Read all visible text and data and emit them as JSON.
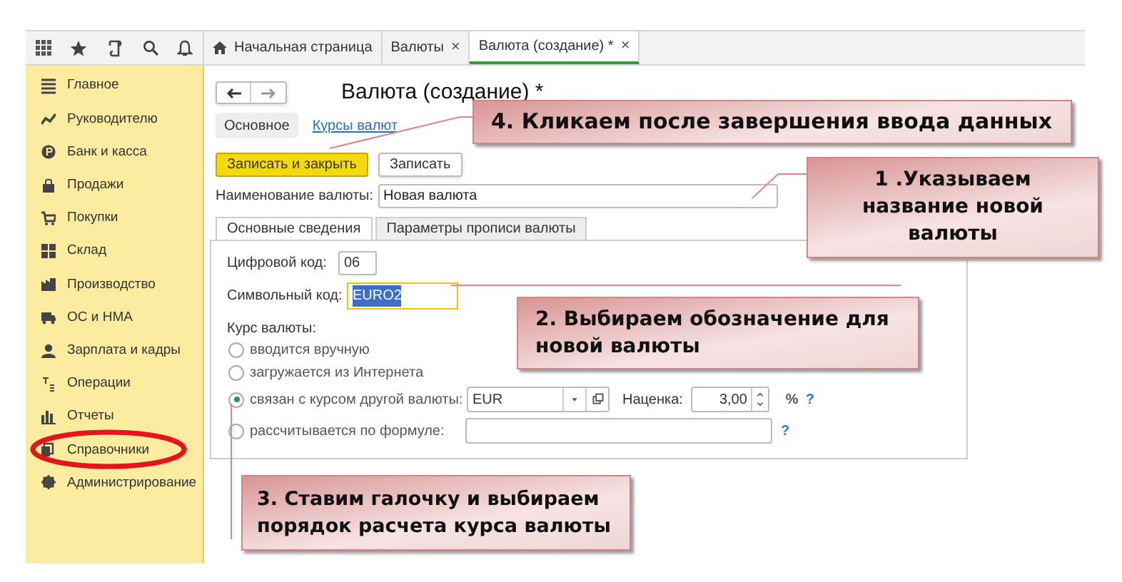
{
  "tabs": [
    {
      "label": "Начальная страница",
      "home": true,
      "closable": false,
      "selected": false
    },
    {
      "label": "Валюты",
      "home": false,
      "closable": true,
      "selected": false
    },
    {
      "label": "Валюта (создание) *",
      "home": false,
      "closable": true,
      "selected": true
    }
  ],
  "close_glyph": "×",
  "sidebar": {
    "items": [
      {
        "label": "Главное",
        "circled": false
      },
      {
        "label": "Руководителю",
        "circled": false
      },
      {
        "label": "Банк и касса",
        "circled": false
      },
      {
        "label": "Продажи",
        "circled": false
      },
      {
        "label": "Покупки",
        "circled": false
      },
      {
        "label": "Склад",
        "circled": false
      },
      {
        "label": "Производство",
        "circled": false
      },
      {
        "label": "ОС и НМА",
        "circled": false
      },
      {
        "label": "Зарплата и кадры",
        "circled": false
      },
      {
        "label": "Операции",
        "circled": false
      },
      {
        "label": "Отчеты",
        "circled": false
      },
      {
        "label": "Справочники",
        "circled": true
      },
      {
        "label": "Администрирование",
        "circled": false
      }
    ]
  },
  "form": {
    "title": "Валюта (создание) *",
    "sections": [
      {
        "label": "Основное",
        "kind": "button"
      },
      {
        "label": "Курсы валют",
        "kind": "link"
      }
    ],
    "actions": [
      {
        "label": "Записать и закрыть",
        "primary": true
      },
      {
        "label": "Записать",
        "primary": false
      }
    ],
    "name_field": {
      "label": "Наименование валюты:",
      "value": "Новая валюта"
    },
    "tabs": [
      {
        "label": "Основные сведения",
        "selected": true
      },
      {
        "label": "Параметры прописи валюты",
        "selected": false
      }
    ],
    "digital_code": {
      "label": "Цифровой код:",
      "value": "06"
    },
    "symbol_code": {
      "label": "Символьный код:",
      "value": "EURO2",
      "focused": true
    },
    "rate_label": "Курс валюты:",
    "rate_options": [
      {
        "label": "вводится вручную",
        "selected": false
      },
      {
        "label": "загружается из Интернета",
        "selected": false
      },
      {
        "label": "связан с курсом другой валюты:",
        "selected": true
      },
      {
        "label": "рассчитывается по формуле:",
        "selected": false
      }
    ],
    "base_currency": {
      "value": "EUR"
    },
    "markup": {
      "label": "Наценка:",
      "value": "3,00",
      "unit": "%"
    },
    "help": [
      "?",
      "?"
    ]
  },
  "callouts": [
    {
      "lines": [
        "4. Кликаем после завершения ввода данных"
      ]
    },
    {
      "lines": [
        "1 .Указываем",
        "название новой",
        "валюты"
      ]
    },
    {
      "lines": [
        "2. Выбираем обозначение для",
        "новой валюты"
      ]
    },
    {
      "lines": [
        "3. Ставим галочку и выбираем",
        "порядок расчета курса валюты"
      ]
    }
  ]
}
